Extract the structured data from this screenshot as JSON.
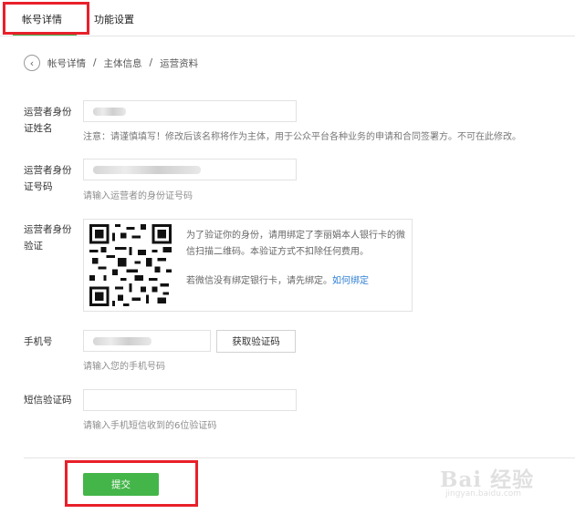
{
  "tabs": [
    {
      "label": "帐号详情"
    },
    {
      "label": "功能设置"
    }
  ],
  "breadcrumb": {
    "items": [
      "帐号详情",
      "主体信息",
      "运营资料"
    ],
    "separator": "/"
  },
  "form": {
    "name": {
      "label": "运营者身份证姓名",
      "note": "注意：请谨慎填写！修改后该名称将作为主体，用于公众平台各种业务的申请和合同签署方。不可在此修改。"
    },
    "idcard": {
      "label": "运营者身份证号码",
      "hint": "请输入运营者的身份证号码"
    },
    "verify": {
      "label": "运营者身份验证",
      "text": "为了验证你的身份，请用绑定了李丽娟本人银行卡的微信扫描二维码。本验证方式不扣除任何费用。",
      "no_card_text": "若微信没有绑定银行卡，请先绑定。",
      "how_to_bind": "如何绑定"
    },
    "phone": {
      "label": "手机号",
      "get_code_button": "获取验证码",
      "hint": "请输入您的手机号码"
    },
    "sms": {
      "label": "短信验证码",
      "value": "",
      "hint": "请输入手机短信收到的6位验证码"
    },
    "submit_label": "提交"
  },
  "watermark": {
    "logo": "Bai 经验",
    "url": "jingyan.baidu.com"
  },
  "colors": {
    "accent": "#44b549",
    "highlight": "#e8202a",
    "link": "#2f7fd3"
  }
}
